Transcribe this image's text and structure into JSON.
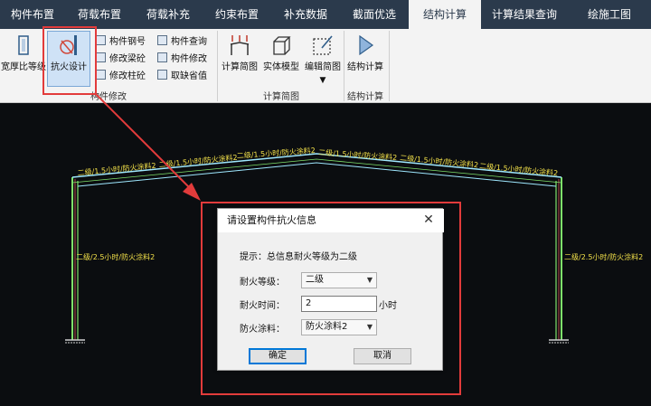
{
  "menu": {
    "tabs": [
      {
        "label": "构件布置",
        "active": false
      },
      {
        "label": "荷载布置",
        "active": false
      },
      {
        "label": "荷载补充",
        "active": false
      },
      {
        "label": "约束布置",
        "active": false
      },
      {
        "label": "补充数据",
        "active": false
      },
      {
        "label": "截面优选",
        "active": false
      },
      {
        "label": "结构计算",
        "active": true
      },
      {
        "label": "计算结果查询",
        "active": false
      },
      {
        "label": "绘施工图",
        "active": false
      }
    ]
  },
  "ribbon": {
    "group1": {
      "label": "构件修改",
      "thickness_ratio": "宽厚比等级",
      "fire_design": "抗火设计",
      "rebar": "构件钢号",
      "beam_concrete": "修改梁砼",
      "column_concrete": "修改柱砼",
      "query": "构件查询",
      "modify": "构件修改",
      "default_value": "取缺省值"
    },
    "group2": {
      "label": "计算简图",
      "diagram": "计算简图",
      "solid_model": "实体模型",
      "edit_diagram": "编辑简图"
    },
    "group3": {
      "label": "结构计算",
      "run": "结构计算"
    }
  },
  "canvas": {
    "rafter_label": "二级/1.5小时/防火涂料2",
    "column_label": "二级/2.5小时/防火涂料2"
  },
  "dialog": {
    "title": "请设置构件抗火信息",
    "hint": "提示：总信息耐火等级为二级",
    "fire_rating_label": "耐火等级：",
    "fire_rating_value": "二级",
    "fire_time_label": "耐火时间：",
    "fire_time_value": "2",
    "fire_time_unit": "小时",
    "coating_label": "防火涂料：",
    "coating_value": "防火涂料2",
    "ok": "确定",
    "cancel": "取消"
  },
  "colors": {
    "menu_bg": "#2b3a4c",
    "canvas_bg": "#0b0d10",
    "highlight_red": "#e23b3b",
    "member_green": "#7ee06a",
    "member_cyan": "#9fe8ff",
    "label_yellow": "#f4e24a"
  }
}
